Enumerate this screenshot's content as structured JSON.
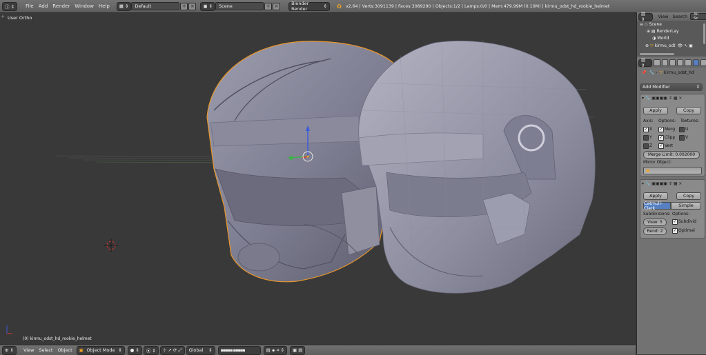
{
  "topbar": {
    "menus": [
      "File",
      "Add",
      "Render",
      "Window",
      "Help"
    ],
    "layout": "Default",
    "scene": "Scene",
    "engine": "Blender Render",
    "stats": "v2.64 | Verts:3091139 | Faces:3089290 | Objects:1/2 | Lamps:0/0 | Mem:479.99M (0.10M) | kirmu_odst_hd_rookie_helmet"
  },
  "viewport": {
    "view_label": "User Ortho",
    "object_label": "(0) kirmu_odst_hd_rookie_helmet"
  },
  "bottombar": {
    "menus": [
      "View",
      "Select",
      "Object"
    ],
    "mode": "Object Mode",
    "orientation": "Global"
  },
  "outliner": {
    "header": [
      "View",
      "Search",
      "All Sc"
    ],
    "items": [
      "Scene",
      "RenderLay",
      "World",
      "kirmu_odt"
    ]
  },
  "properties": {
    "object_name": "kirmu_odst_hd",
    "add_modifier": "Add Modifier",
    "mirror": {
      "apply": "Apply",
      "copy": "Copy",
      "axis": "Axis:",
      "options": "Options:",
      "textures": "Textures:",
      "x": "X",
      "y": "Y",
      "z": "Z",
      "merge": "Merg",
      "clip": "Clipp",
      "vert": "Vert",
      "u": "U",
      "v": "V",
      "merge_limit": "Merge Limit: 0.002000",
      "mirror_object": "Mirror Object:"
    },
    "subsurf": {
      "apply": "Apply",
      "copy": "Copy",
      "catmull": "Catmull-Clark",
      "simple": "Simple",
      "subdivisions": "Subdivisions:",
      "options": "Options:",
      "view": "View: 5",
      "render": "Rend: 2",
      "subdivuv": "Subdivid",
      "optimal": "Optimal"
    }
  },
  "colors": {
    "selection_outline": "#e8962a",
    "active_field": "#5680c2"
  }
}
